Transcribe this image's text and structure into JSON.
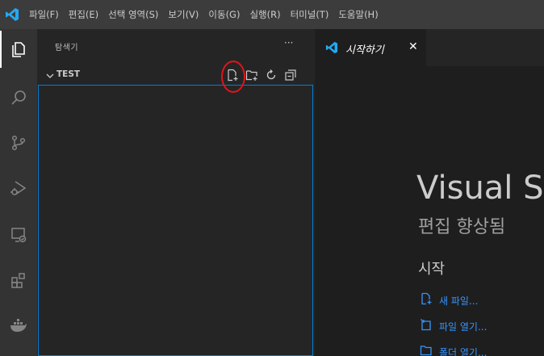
{
  "menu": {
    "items": [
      "파일(F)",
      "편집(E)",
      "선택 영역(S)",
      "보기(V)",
      "이동(G)",
      "실행(R)",
      "터미널(T)",
      "도움말(H)"
    ]
  },
  "activity_bar": {
    "icons": [
      "files-icon",
      "search-icon",
      "source-control-icon",
      "run-debug-icon",
      "remote-explorer-icon",
      "extensions-icon",
      "docker-icon"
    ]
  },
  "sidebar": {
    "title": "탐색기",
    "more_label": "···",
    "section_title": "TEST",
    "tools": [
      "new-file-icon",
      "new-folder-icon",
      "refresh-icon",
      "collapse-all-icon"
    ]
  },
  "tabs": [
    {
      "label": "시작하기",
      "close": "✕"
    }
  ],
  "welcome": {
    "title": "Visual Studio Code",
    "subtitle": "편집 향상됨",
    "start_heading": "시작",
    "links": [
      {
        "label": "새 파일...",
        "icon": "new-file-icon"
      },
      {
        "label": "파일 열기...",
        "icon": "open-file-icon"
      },
      {
        "label": "폴더 열기...",
        "icon": "open-folder-icon"
      }
    ]
  },
  "colors": {
    "accent": "#007fd4",
    "annotation": "#e0151a",
    "link": "#3794ff",
    "vscode_blue": "#23a9f2"
  }
}
